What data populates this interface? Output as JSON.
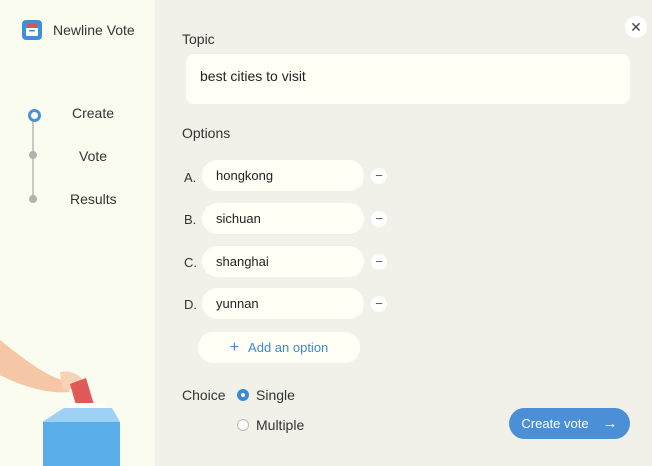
{
  "app": {
    "title": "Newline Vote",
    "icon": "ballot-icon"
  },
  "steps": [
    {
      "label": "Create",
      "active": true
    },
    {
      "label": "Vote",
      "active": false
    },
    {
      "label": "Results",
      "active": false
    }
  ],
  "topic": {
    "label": "Topic",
    "value": "best cities to visit"
  },
  "options": {
    "label": "Options",
    "items": [
      {
        "letter": "A.",
        "value": "hongkong"
      },
      {
        "letter": "B.",
        "value": "sichuan"
      },
      {
        "letter": "C.",
        "value": "shanghai"
      },
      {
        "letter": "D.",
        "value": "yunnan"
      }
    ],
    "add_label": "Add an option"
  },
  "choice": {
    "label": "Choice",
    "single_label": "Single",
    "multiple_label": "Multiple",
    "selected": "Single"
  },
  "create_button": {
    "label": "Create vote"
  },
  "colors": {
    "accent": "#4b8fd6",
    "sidebar_bg": "#fbfcf0",
    "main_bg": "#f1f1ea"
  }
}
